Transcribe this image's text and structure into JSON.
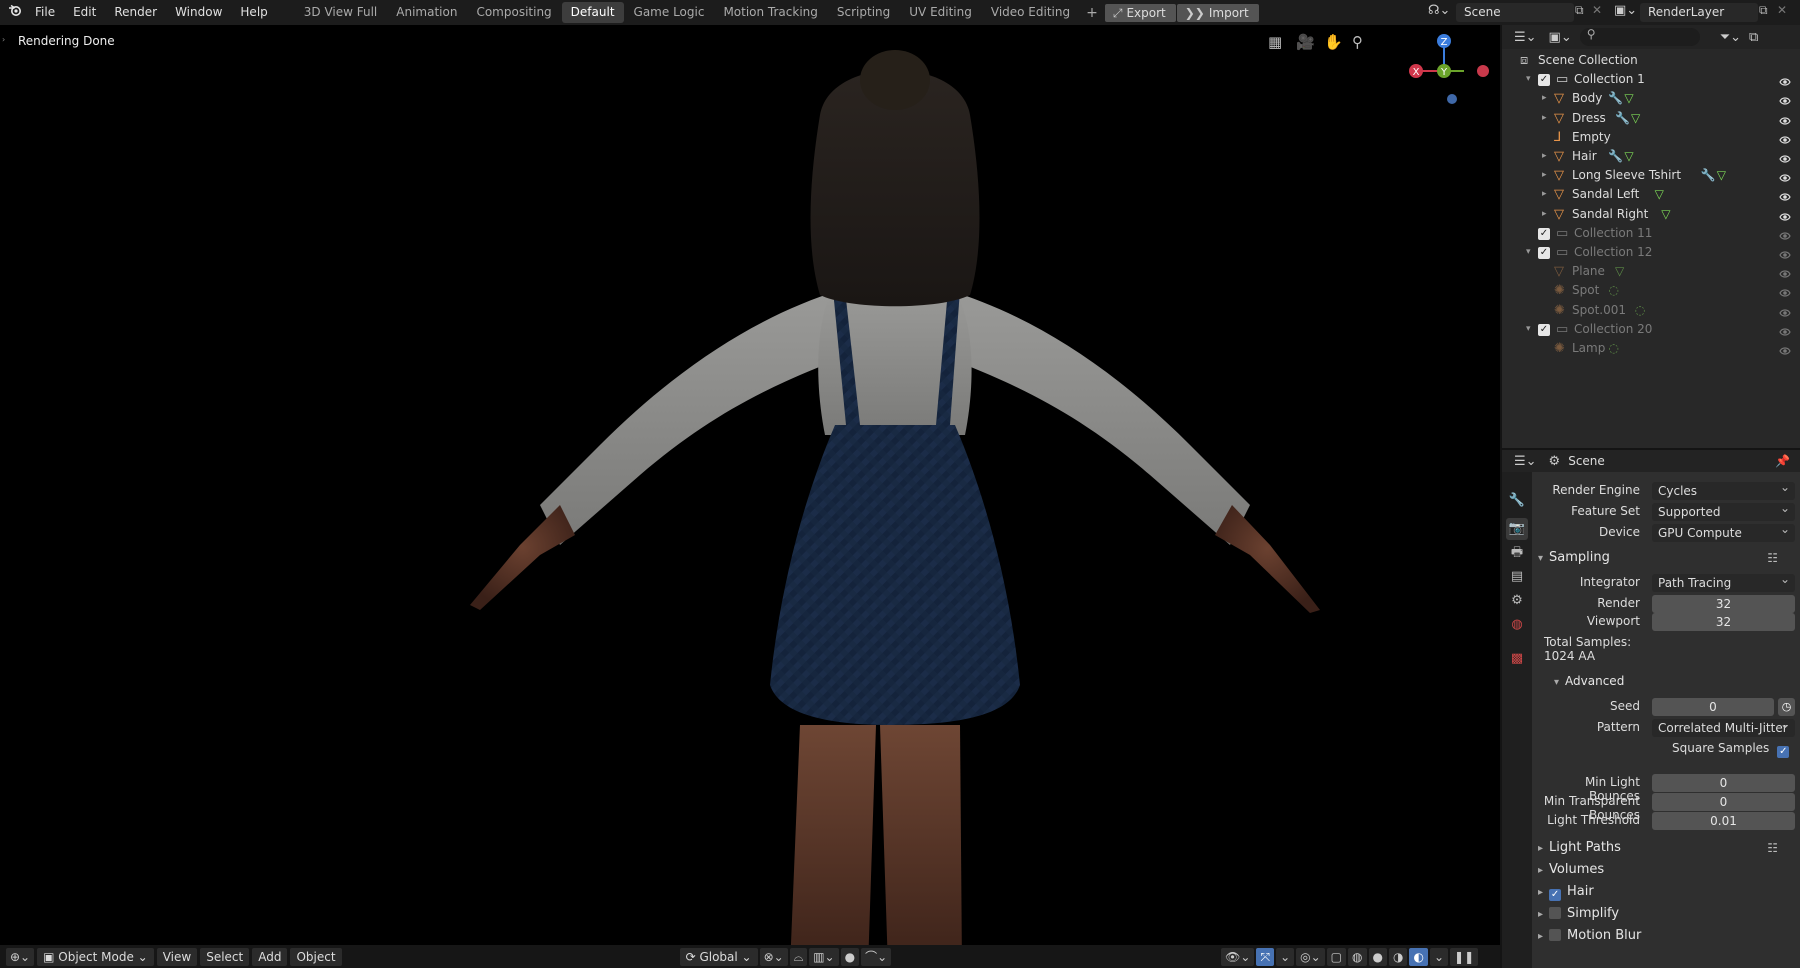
{
  "menu": [
    "File",
    "Edit",
    "Render",
    "Window",
    "Help"
  ],
  "workspace_tabs": [
    "3D View Full",
    "Animation",
    "Compositing",
    "Default",
    "Game Logic",
    "Motion Tracking",
    "Scripting",
    "UV Editing",
    "Video Editing"
  ],
  "active_workspace": "Default",
  "export_label": "Export",
  "import_label": "Import",
  "scene_name": "Scene",
  "render_layer": "RenderLayer",
  "viewport": {
    "status": "Rendering Done",
    "mode": "Object Mode",
    "menus": [
      "View",
      "Select",
      "Add",
      "Object"
    ],
    "orientation": "Global",
    "gizmo": {
      "x": "X",
      "y": "Y",
      "z": "Z"
    }
  },
  "outliner": {
    "root": "Scene Collection",
    "rows": [
      {
        "label": "Collection 1",
        "kind": "collection",
        "depth": 0,
        "dim": false,
        "toggle": "▾",
        "checked": true,
        "extras": []
      },
      {
        "label": "Body",
        "kind": "mesh",
        "depth": 1,
        "dim": false,
        "toggle": "▸",
        "extras": [
          "wrench",
          "mesh"
        ]
      },
      {
        "label": "Dress",
        "kind": "mesh",
        "depth": 1,
        "dim": false,
        "toggle": "▸",
        "extras": [
          "wrench",
          "mesh"
        ]
      },
      {
        "label": "Empty",
        "kind": "empty",
        "depth": 1,
        "dim": false,
        "toggle": "",
        "extras": []
      },
      {
        "label": "Hair",
        "kind": "mesh",
        "depth": 1,
        "dim": false,
        "toggle": "▸",
        "extras": [
          "wrench",
          "mesh"
        ]
      },
      {
        "label": "Long Sleeve Tshirt",
        "kind": "mesh",
        "depth": 1,
        "dim": false,
        "toggle": "▸",
        "extras": [
          "wrench",
          "mesh"
        ]
      },
      {
        "label": "Sandal Left",
        "kind": "mesh",
        "depth": 1,
        "dim": false,
        "toggle": "▸",
        "extras": [
          "mesh"
        ]
      },
      {
        "label": "Sandal Right",
        "kind": "mesh",
        "depth": 1,
        "dim": false,
        "toggle": "▸",
        "extras": [
          "mesh"
        ]
      },
      {
        "label": "Collection 11",
        "kind": "collection",
        "depth": 0,
        "dim": true,
        "toggle": "",
        "checked": true,
        "extras": []
      },
      {
        "label": "Collection 12",
        "kind": "collection",
        "depth": 0,
        "dim": true,
        "toggle": "▾",
        "checked": true,
        "extras": []
      },
      {
        "label": "Plane",
        "kind": "mesh",
        "depth": 1,
        "dim": true,
        "toggle": "",
        "extras": [
          "mesh"
        ]
      },
      {
        "label": "Spot",
        "kind": "light",
        "depth": 1,
        "dim": true,
        "toggle": "",
        "extras": [
          "lightdata"
        ]
      },
      {
        "label": "Spot.001",
        "kind": "light",
        "depth": 1,
        "dim": true,
        "toggle": "",
        "extras": [
          "lightdata"
        ]
      },
      {
        "label": "Collection 20",
        "kind": "collection",
        "depth": 0,
        "dim": true,
        "toggle": "▾",
        "checked": true,
        "extras": []
      },
      {
        "label": "Lamp",
        "kind": "light",
        "depth": 1,
        "dim": true,
        "toggle": "",
        "extras": [
          "lightdata"
        ]
      }
    ]
  },
  "properties": {
    "title": "Scene",
    "render_engine": {
      "label": "Render Engine",
      "value": "Cycles"
    },
    "feature_set": {
      "label": "Feature Set",
      "value": "Supported"
    },
    "device": {
      "label": "Device",
      "value": "GPU Compute"
    },
    "sampling": {
      "title": "Sampling",
      "integrator": {
        "label": "Integrator",
        "value": "Path Tracing"
      },
      "render": {
        "label": "Render",
        "value": "32"
      },
      "viewport": {
        "label": "Viewport",
        "value": "32"
      },
      "total_label": "Total Samples:",
      "total_value": "1024 AA",
      "advanced": "Advanced",
      "seed": {
        "label": "Seed",
        "value": "0"
      },
      "pattern": {
        "label": "Pattern",
        "value": "Correlated Multi-Jitter"
      },
      "square_samples": {
        "label": "Square Samples",
        "checked": true
      },
      "min_light_bounces": {
        "label": "Min Light Bounces",
        "value": "0"
      },
      "min_transparent_bounces": {
        "label": "Min Transparent Bounces",
        "value": "0"
      },
      "light_threshold": {
        "label": "Light Threshold",
        "value": "0.01"
      }
    },
    "panels": [
      {
        "label": "Light Paths",
        "checkbox": null
      },
      {
        "label": "Volumes",
        "checkbox": null
      },
      {
        "label": "Hair",
        "checkbox": true
      },
      {
        "label": "Simplify",
        "checkbox": false
      },
      {
        "label": "Motion Blur",
        "checkbox": false
      }
    ]
  }
}
